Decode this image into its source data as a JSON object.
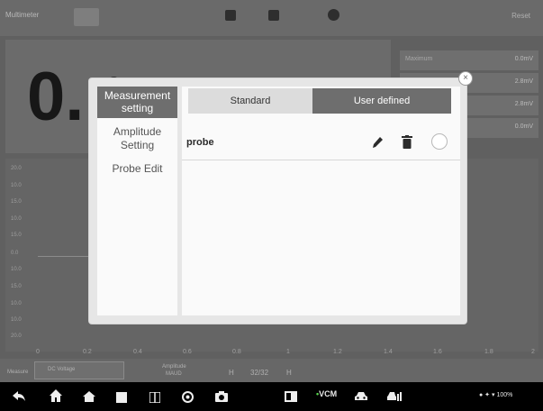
{
  "app": {
    "title": "Multimeter",
    "right_label": "Reset",
    "big_value": "0.",
    "big_value_partial": "0",
    "measurements": [
      {
        "label": "Maximum",
        "value": "0.0mV"
      },
      {
        "label": "",
        "value": "2.8mV"
      },
      {
        "label": "",
        "value": "2.8mV"
      },
      {
        "label": "",
        "value": "0.0mV"
      }
    ],
    "y_ticks": [
      "20.0",
      "10.0",
      "15.0",
      "10.0",
      "15.0",
      "0.0",
      "10.0",
      "15.0",
      "10.0",
      "10.0",
      "20.0"
    ],
    "x_ticks": [
      "0",
      "0.2",
      "0.4",
      "0.6",
      "0.8",
      "1",
      "1.2",
      "1.4",
      "1.6",
      "1.8",
      "2"
    ],
    "bottom": {
      "measure_label": "Measure",
      "measure_value": "DC Voltage",
      "amplitude_label": "Amplitude",
      "amplitude_value": "MAUD",
      "h_left": "H",
      "page": "32/32",
      "h_right": "H"
    }
  },
  "dialog": {
    "sidebar": [
      {
        "label": "Measurement setting",
        "active": true
      },
      {
        "label": "Amplitude Setting",
        "active": false
      },
      {
        "label": "Probe Edit",
        "active": false
      }
    ],
    "segments": {
      "standard": "Standard",
      "user_defined": "User defined",
      "selected": "user_defined"
    },
    "rows": [
      {
        "name": "probe",
        "selected": false
      }
    ],
    "close_icon": "close-icon"
  },
  "navbar": {
    "icons": [
      "back-icon",
      "home-icon",
      "house-icon",
      "recent-apps-icon",
      "split-screen-icon",
      "browser-icon",
      "camera-icon",
      "screen-mirror-icon",
      "vcm-icon",
      "car-icon",
      "diagnostic-icon"
    ],
    "vcm_label": "VCM",
    "status_text": "100%"
  },
  "colors": {
    "dialog_bg": "#e6e6e6",
    "pane_bg": "#fafafa",
    "active_tab": "#6e6e6e",
    "navbar": "#000000"
  }
}
